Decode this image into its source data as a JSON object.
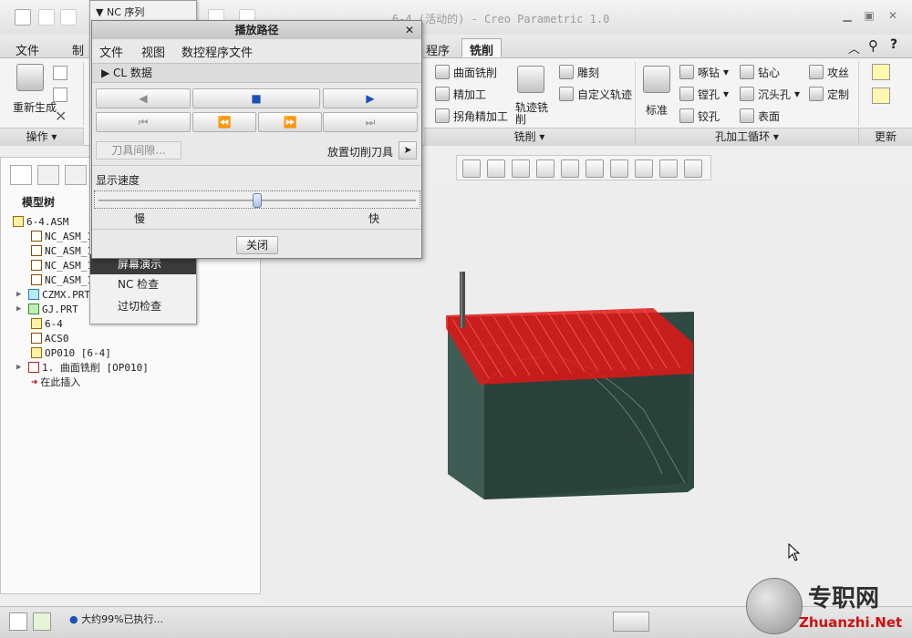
{
  "window": {
    "title": "6-4 (活动的) - Creo Parametric 1.0"
  },
  "ribbon_tabs": [
    "文件",
    "制",
    "程序",
    "铣削"
  ],
  "active_tab": "铣削",
  "ribbon": {
    "regenerate_label": "重新生成",
    "groups": {
      "operations": "操作",
      "milling": "铣削",
      "hole_cycles": "孔加工循环",
      "update": "更新"
    },
    "milling_items": [
      "曲面铣削",
      "精加工",
      "拐角精加工"
    ],
    "trajectory_label": "轨迹铣削",
    "engrave_items": [
      "雕刻",
      "自定义轨迹"
    ],
    "standard_label": "标准",
    "hole_items_col1": [
      "啄钻",
      "镗孔",
      "铰孔"
    ],
    "hole_items_col2": [
      "钻心",
      "沉头孔",
      "表面"
    ],
    "hole_items_col3": [
      "攻丝",
      "定制"
    ]
  },
  "nc_sequence_menu": {
    "title": "NC 序列",
    "items": [
      "屏幕演示",
      "NC 检查",
      "过切检查"
    ],
    "selected_index": 0
  },
  "model_tree": {
    "header": "模型树",
    "items": [
      "6-4.ASM",
      "NC_ASM_1",
      "NC_ASM_1",
      "NC_ASM_1",
      "NC_ASM_1",
      "CZMX.PRT",
      "GJ.PRT",
      "6-4",
      "ACS0",
      "OP010 [6-4]",
      "1. 曲面铣削 [OP010]",
      "在此插入"
    ]
  },
  "dialog": {
    "title": "播放路径",
    "menu": [
      "文件",
      "视图",
      "数控程序文件"
    ],
    "cl_data": "CL 数据",
    "tool_clearance": "刀具间隙...",
    "place_cutter": "放置切削刀具",
    "speed_label": "显示速度",
    "speed_slow": "慢",
    "speed_fast": "快",
    "speed_value": 0.5,
    "close": "关闭"
  },
  "status": {
    "message": "大约99%已执行..."
  },
  "watermark": {
    "cn": "专职网",
    "en": "Zhuanzhi.Net"
  },
  "colors": {
    "toolpath": "#e01818",
    "part": "#2f4a42"
  }
}
